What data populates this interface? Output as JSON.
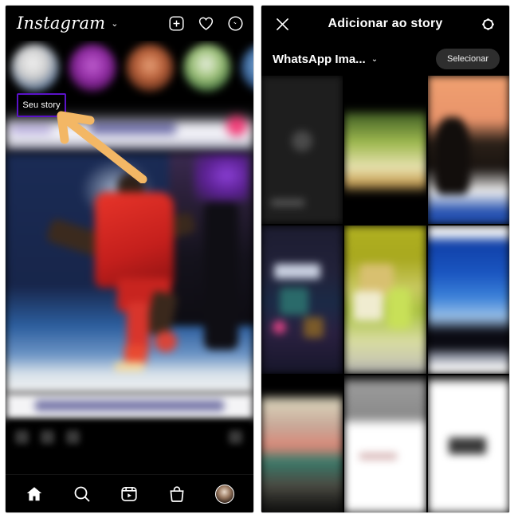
{
  "left_phone": {
    "app": "Instagram",
    "topbar": {
      "logo_text": "Instagram",
      "logo_chevron": "⌄",
      "icons": [
        {
          "name": "new-post-icon",
          "label": "Novo"
        },
        {
          "name": "activity-heart-icon",
          "label": "Atividade"
        },
        {
          "name": "messenger-icon",
          "label": "Direct"
        }
      ]
    },
    "story_tray": {
      "items": [
        {
          "name": "Seu story",
          "blurred": true
        },
        {
          "name": "",
          "blurred": true
        },
        {
          "name": "",
          "blurred": true
        },
        {
          "name": "",
          "blurred": true
        },
        {
          "name": "",
          "blurred": true
        }
      ]
    },
    "annotation": {
      "callout_label": "Seu story",
      "callout_border_color": "#5a12c8",
      "arrow_color": "#f3b765",
      "arrow_direction": "up-left"
    },
    "post": {
      "header_blurred": true,
      "image_description": "Jogador de futebol com uniforme vermelho",
      "caption_blurred": true,
      "actions_blurred": true
    },
    "bottom_nav": [
      {
        "name": "home-icon",
        "label": "Início",
        "active": true
      },
      {
        "name": "search-icon",
        "label": "Pesquisar",
        "active": false
      },
      {
        "name": "reels-icon",
        "label": "Reels",
        "active": false
      },
      {
        "name": "shop-icon",
        "label": "Loja",
        "active": false
      },
      {
        "name": "profile-avatar",
        "label": "Perfil",
        "active": false
      }
    ]
  },
  "right_phone": {
    "topbar": {
      "close_label": "Fechar",
      "title": "Adicionar ao story",
      "settings_label": "Configurações"
    },
    "subbar": {
      "album_name": "WhatsApp Ima...",
      "album_chevron": "⌄",
      "select_button": "Selecionar"
    },
    "gallery": {
      "columns": 3,
      "cells": [
        {
          "name": "create-tile",
          "kind": "create",
          "blurred": true
        },
        {
          "name": "gallery-thumb",
          "kind": "green-scene",
          "blurred": true
        },
        {
          "name": "gallery-thumb",
          "kind": "orange-portrait",
          "blurred": true
        },
        {
          "name": "gallery-thumb",
          "kind": "navy-screenshot",
          "blurred": true
        },
        {
          "name": "gallery-thumb",
          "kind": "olive-scene",
          "blurred": true
        },
        {
          "name": "gallery-thumb",
          "kind": "blue-sky",
          "blurred": true
        },
        {
          "name": "gallery-thumb",
          "kind": "portrait-photo",
          "blurred": true
        },
        {
          "name": "gallery-thumb",
          "kind": "white-document",
          "blurred": true
        },
        {
          "name": "gallery-thumb",
          "kind": "white-document-dark-block",
          "blurred": true
        }
      ]
    }
  },
  "colors": {
    "background": "#ffffff",
    "phone_bg": "#000000",
    "accent_purple": "#5a12c8",
    "accent_orange": "#f3b765",
    "button_gray": "#2e2e2e",
    "text_white": "#ffffff"
  }
}
